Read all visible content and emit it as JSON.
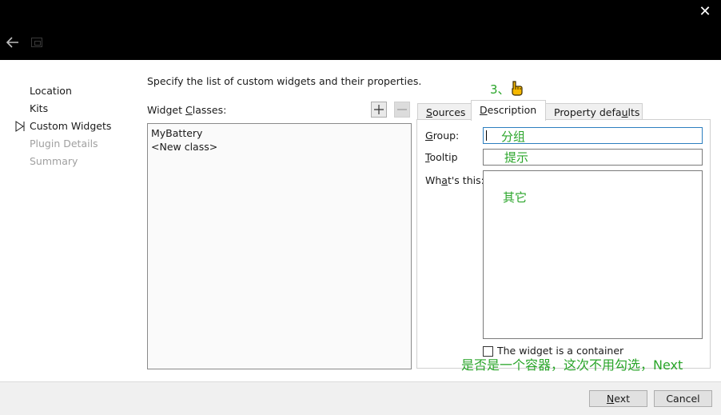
{
  "window": {
    "close_glyph": "✕"
  },
  "steps": [
    {
      "label": "Location",
      "state": "done"
    },
    {
      "label": "Kits",
      "state": "done"
    },
    {
      "label": "Custom Widgets",
      "state": "current"
    },
    {
      "label": "Plugin Details",
      "state": "disabled"
    },
    {
      "label": "Summary",
      "state": "disabled"
    }
  ],
  "intro_text": "Specify the list of custom widgets and their properties.",
  "widget_classes": {
    "label_pre": "Widget ",
    "label_mnemonic": "C",
    "label_post": "lasses:",
    "add_glyph": "+",
    "remove_glyph": "−",
    "items": [
      "MyBattery",
      "<New class>"
    ]
  },
  "tabs": [
    {
      "mnemonic": "S",
      "rest": "ources",
      "pre": "",
      "active": false
    },
    {
      "mnemonic": "D",
      "rest": "escription",
      "pre": "",
      "active": true
    },
    {
      "pre": "Property defa",
      "mnemonic": "u",
      "rest": "lts",
      "active": false
    }
  ],
  "description": {
    "group_label_mnemonic": "G",
    "group_label_rest": "roup:",
    "group_value": "",
    "tooltip_label_mnemonic": "T",
    "tooltip_label_rest": "ooltip",
    "tooltip_value": "",
    "whatsthis_label_pre": "Wh",
    "whatsthis_label_mnemonic": "a",
    "whatsthis_label_rest": "t's this:",
    "whatsthis_value": "",
    "container_checkbox_label": "The widget is a container",
    "container_checked": false
  },
  "annotations": {
    "step": "3、",
    "group": "分组",
    "tooltip": "提示",
    "whatsthis": "其它",
    "bottom": "是否是一个容器，这次不用勾选，Next",
    "color": "#2aa52a"
  },
  "buttons": {
    "next_mnemonic": "N",
    "next_rest": "ext",
    "cancel_label": "Cancel"
  }
}
